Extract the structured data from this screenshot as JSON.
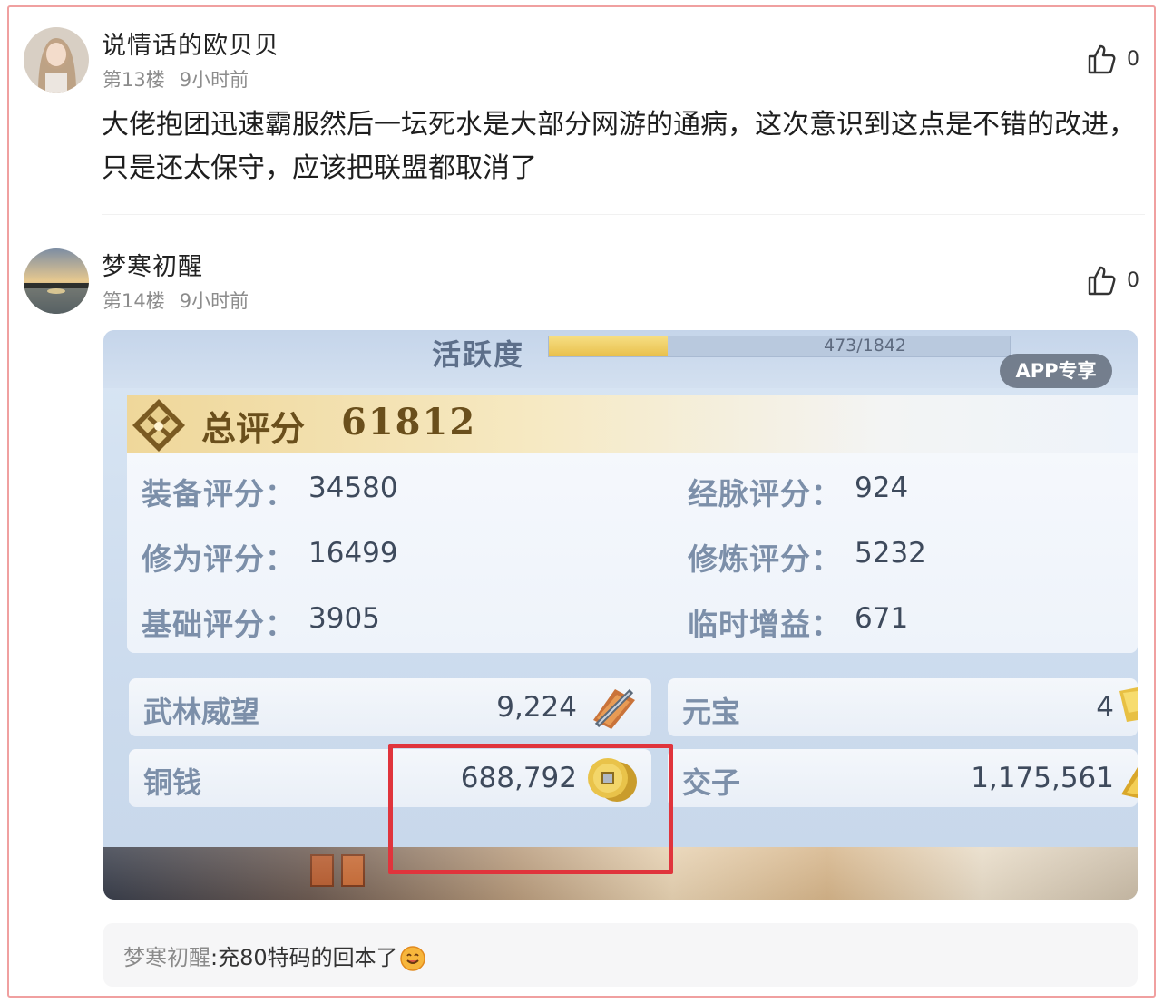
{
  "posts": [
    {
      "username": "说情话的欧贝贝",
      "floor": "第13楼",
      "time": "9小时前",
      "likes": "0",
      "text": "大佬抱团迅速霸服然后一坛死水是大部分网游的通病，这次意识到这点是不错的改进，只是还太保守，应该把联盟都取消了"
    },
    {
      "username": "梦寒初醒",
      "floor": "第14楼",
      "time": "9小时前",
      "likes": "0"
    }
  ],
  "game": {
    "activity_label": "活跃度",
    "activity_value": "473/1842",
    "activity_progress": 0.257,
    "app_badge": "APP专享",
    "total_label": "总评分",
    "total_value": "61812",
    "scores": [
      {
        "label": "装备评分：",
        "value": "34580"
      },
      {
        "label": "经脉评分：",
        "value": "924"
      },
      {
        "label": "修为评分：",
        "value": "16499"
      },
      {
        "label": "修炼评分：",
        "value": "5232"
      },
      {
        "label": "基础评分：",
        "value": "3905"
      },
      {
        "label": "临时增益：",
        "value": "671"
      }
    ],
    "resources": [
      {
        "label": "武林威望",
        "value": "9,224",
        "icon": "sword-badge-icon"
      },
      {
        "label": "元宝",
        "value": "4",
        "icon": "ingot-icon"
      },
      {
        "label": "铜钱",
        "value": "688,792",
        "icon": "copper-coin-icon"
      },
      {
        "label": "交子",
        "value": "1,175,561",
        "icon": "note-icon"
      }
    ]
  },
  "reply": {
    "user": "梦寒初醒",
    "text": ":充80特码的回本了"
  },
  "colors": {
    "highlight": "#e0343c",
    "frame": "#f0a0a0",
    "gold": "#6a4f1c",
    "score_label": "#7c8fa9"
  }
}
